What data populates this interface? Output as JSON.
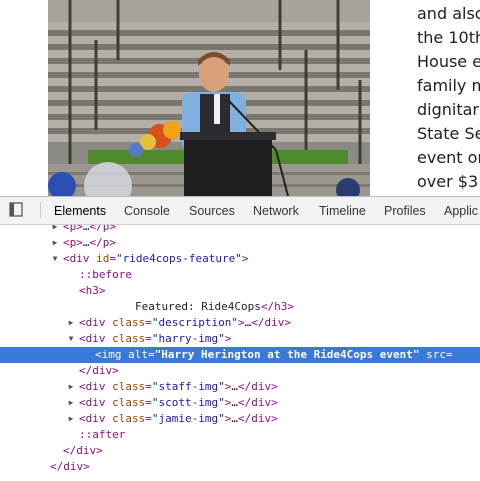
{
  "page": {
    "side_text": [
      "and also",
      "the 10th",
      "House e",
      "family m",
      "dignitar",
      "State Se",
      "event or",
      "over $3"
    ]
  },
  "devtools": {
    "tabs": [
      "Elements",
      "Console",
      "Sources",
      "Network",
      "Timeline",
      "Profiles",
      "Applic"
    ],
    "active_tab": "Elements",
    "dom": {
      "p1_open": "<p>",
      "p1_ellipsis": "…",
      "p1_close": "</p>",
      "p2_open": "<p>",
      "p2_ellipsis": "…",
      "p2_close": "</p>",
      "div_feature_open": "<div",
      "div_feature_attr": "id",
      "div_feature_val": "\"ride4cops-feature\"",
      "div_feature_gt": ">",
      "before": "::before",
      "h3_open": "<h3>",
      "h3_text": "Featured: Ride4Cops",
      "h3_close": "</h3>",
      "desc_open": "<div",
      "desc_attr": "class",
      "desc_val": "\"description\"",
      "desc_gt": ">",
      "desc_ellipsis": "…",
      "desc_close": "</div>",
      "harry_open": "<div",
      "harry_attr": "class",
      "harry_val": "\"harry-img\"",
      "harry_gt": ">",
      "img_open": "<img",
      "img_alt_attr": "alt",
      "img_alt_val": "\"Harry Herington at the Ride4Cops event\"",
      "img_src_attr": "src=",
      "harry_close": "</div>",
      "staff_open": "<div",
      "staff_attr": "class",
      "staff_val": "\"staff-img\"",
      "staff_gt": ">",
      "staff_ellipsis": "…",
      "staff_close": "</div>",
      "scott_open": "<div",
      "scott_attr": "class",
      "scott_val": "\"scott-img\"",
      "scott_gt": ">",
      "scott_ellipsis": "…",
      "scott_close": "</div>",
      "jamie_open": "<div",
      "jamie_attr": "class",
      "jamie_val": "\"jamie-img\"",
      "jamie_gt": ">",
      "jamie_ellipsis": "…",
      "jamie_close": "</div>",
      "after": "::after",
      "feature_close": "</div>",
      "outer_close": "</div>"
    }
  },
  "colors": {
    "selection": "#3879d9",
    "tag": "#881280",
    "attribute": "#994500",
    "value": "#1a1aa6"
  }
}
